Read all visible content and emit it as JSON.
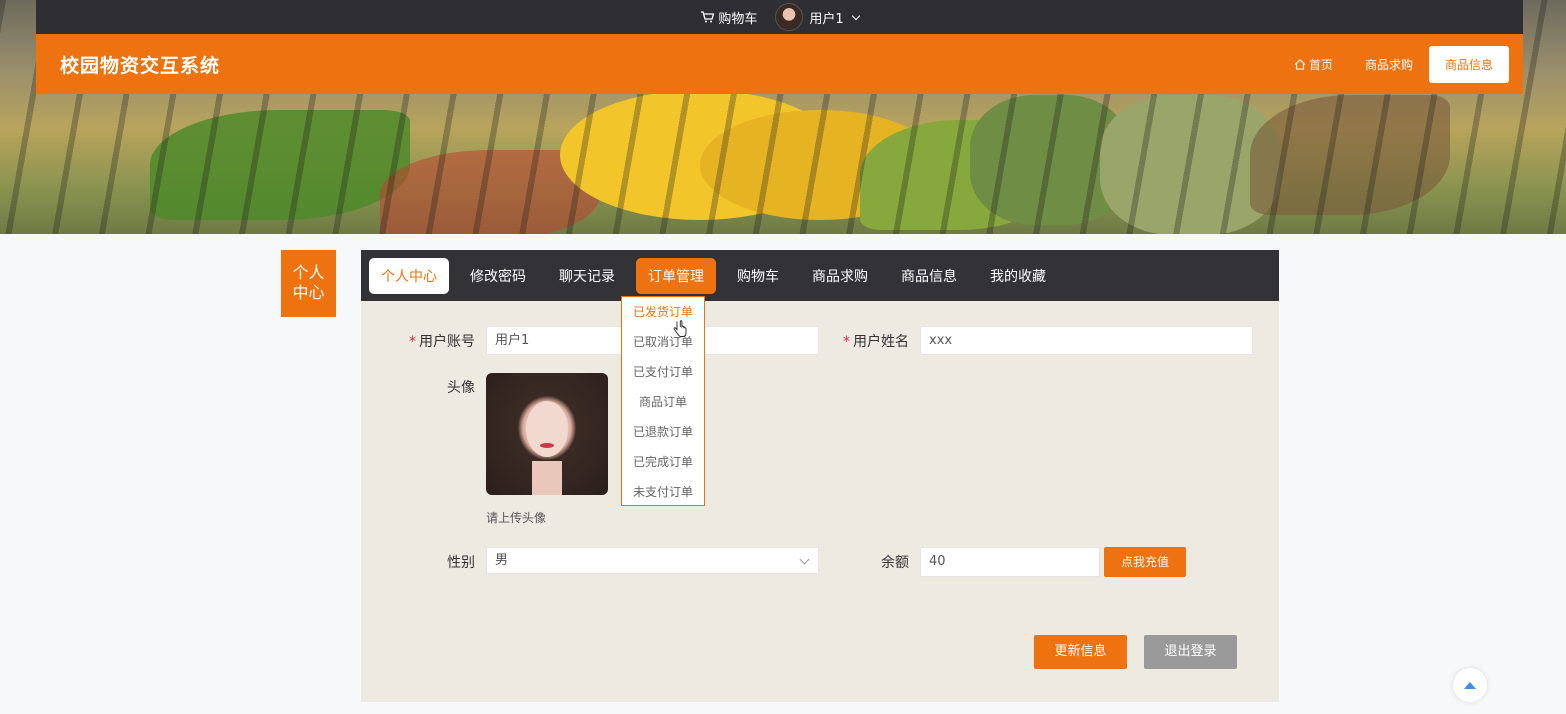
{
  "topbar": {
    "cart_label": "购物车",
    "user_label": "用户1"
  },
  "header": {
    "site_title": "校园物资交互系统",
    "nav": [
      {
        "label": "首页"
      },
      {
        "label": "商品求购"
      },
      {
        "label": "商品信息"
      }
    ]
  },
  "side_label": "个人\n中心",
  "tabs": [
    {
      "label": "个人中心"
    },
    {
      "label": "修改密码"
    },
    {
      "label": "聊天记录"
    },
    {
      "label": "订单管理"
    },
    {
      "label": "购物车"
    },
    {
      "label": "商品求购"
    },
    {
      "label": "商品信息"
    },
    {
      "label": "我的收藏"
    }
  ],
  "dropdown": [
    {
      "label": "已发货订单"
    },
    {
      "label": "已取消订单"
    },
    {
      "label": "已支付订单"
    },
    {
      "label": "商品订单"
    },
    {
      "label": "已退款订单"
    },
    {
      "label": "已完成订单"
    },
    {
      "label": "未支付订单"
    }
  ],
  "form": {
    "account_label": "用户账号",
    "account_value": "用户1",
    "name_label": "用户姓名",
    "name_value": "xxx",
    "avatar_label": "头像",
    "avatar_hint": "请上传头像",
    "gender_label": "性别",
    "gender_value": "男",
    "balance_label": "余额",
    "balance_value": "40",
    "recharge_label": "点我充值",
    "update_label": "更新信息",
    "logout_label": "退出登录"
  },
  "colors": {
    "accent": "#ee7310",
    "dark": "#333337",
    "panel": "#edeae2"
  }
}
